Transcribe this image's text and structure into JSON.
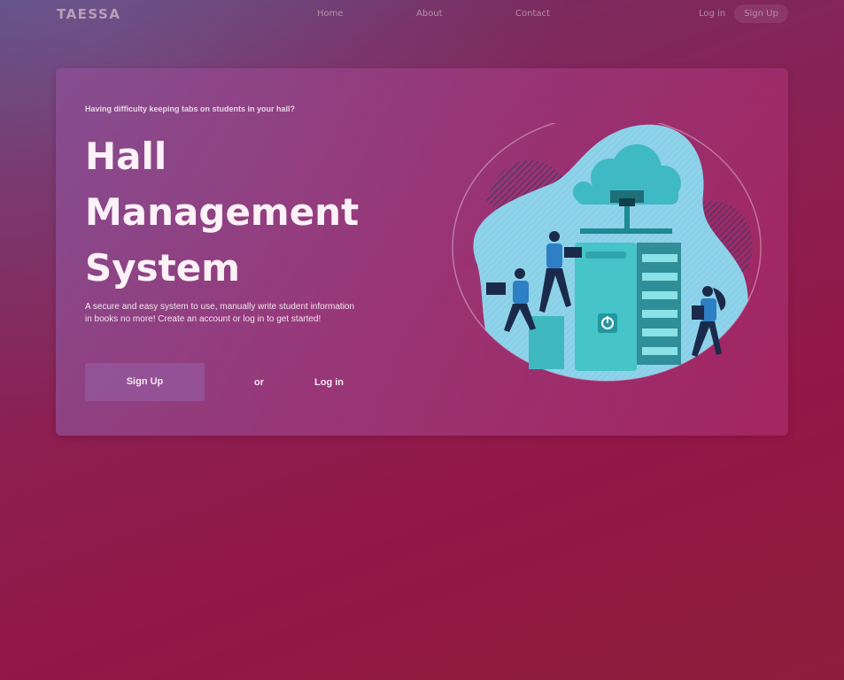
{
  "nav": {
    "logo": "TAESSA",
    "links": [
      "Home",
      "About",
      "Contact"
    ],
    "login": "Log in",
    "signup": "Sign Up"
  },
  "hero": {
    "tagline": "Having difficulty keeping tabs on students in your hall?",
    "title_lines": [
      "Hall",
      "Management",
      "System"
    ],
    "description": "A secure and easy system to use, manually write student information in books no more! Create an account or log in to get started!",
    "signup_button": "Sign Up",
    "or_text": "or",
    "login_button": "Log in"
  },
  "colors": {
    "background": "#931746",
    "card": "#a0428a",
    "illustration_blob": "#8fd3ea",
    "server": "#3fb9bf"
  }
}
